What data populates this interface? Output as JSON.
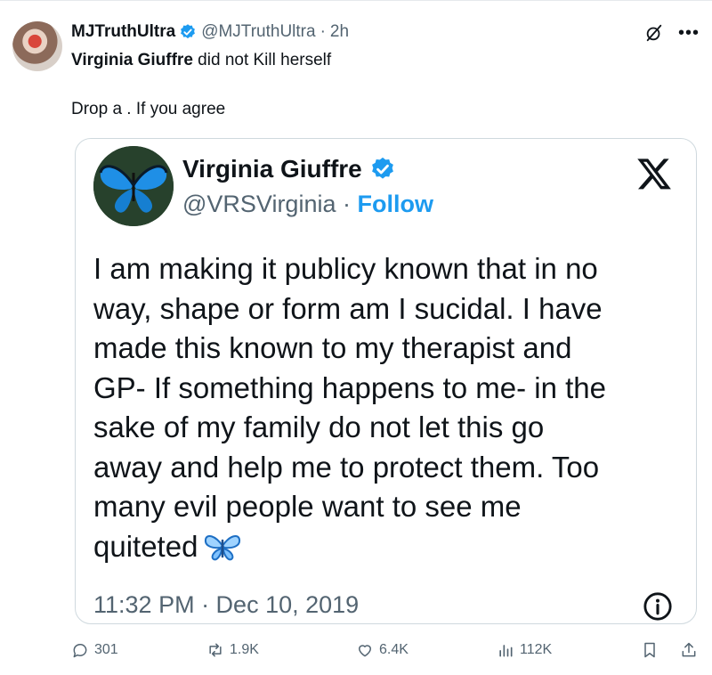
{
  "post": {
    "display_name": "MJTruthUltra",
    "handle": "@MJTruthUltra",
    "separator": "·",
    "time_ago": "2h",
    "text_bold": "Virginia Giuffre",
    "text_rest": " did not Kill herself",
    "text_line2": "Drop a . If you agree"
  },
  "quoted": {
    "display_name": "Virginia Giuffre",
    "handle": "@VRSVirginia",
    "separator": " · ",
    "follow_label": "Follow",
    "body_lines": [
      "I am making it publicy known that in no",
      "way, shape or form am I sucidal. I have",
      "made this known to my therapist and",
      "GP- If something happens to me- in the",
      "sake of my family do not let this go",
      "away and help me to protect them. Too",
      "many evil people want to see me",
      "quiteted"
    ],
    "timestamp": "11:32 PM · Dec 10, 2019"
  },
  "actions": {
    "replies": "301",
    "reposts": "1.9K",
    "likes": "6.4K",
    "views": "112K"
  },
  "icons": [
    "verified-badge-icon",
    "grok-icon",
    "more-icon",
    "x-logo-icon",
    "butterfly-emoji-icon",
    "info-icon",
    "reply-icon",
    "repost-icon",
    "like-icon",
    "views-icon",
    "bookmark-icon",
    "share-icon"
  ],
  "colors": {
    "accent": "#1d9bf0",
    "text": "#0f1419",
    "muted": "#536471",
    "border": "#cfd9de"
  }
}
